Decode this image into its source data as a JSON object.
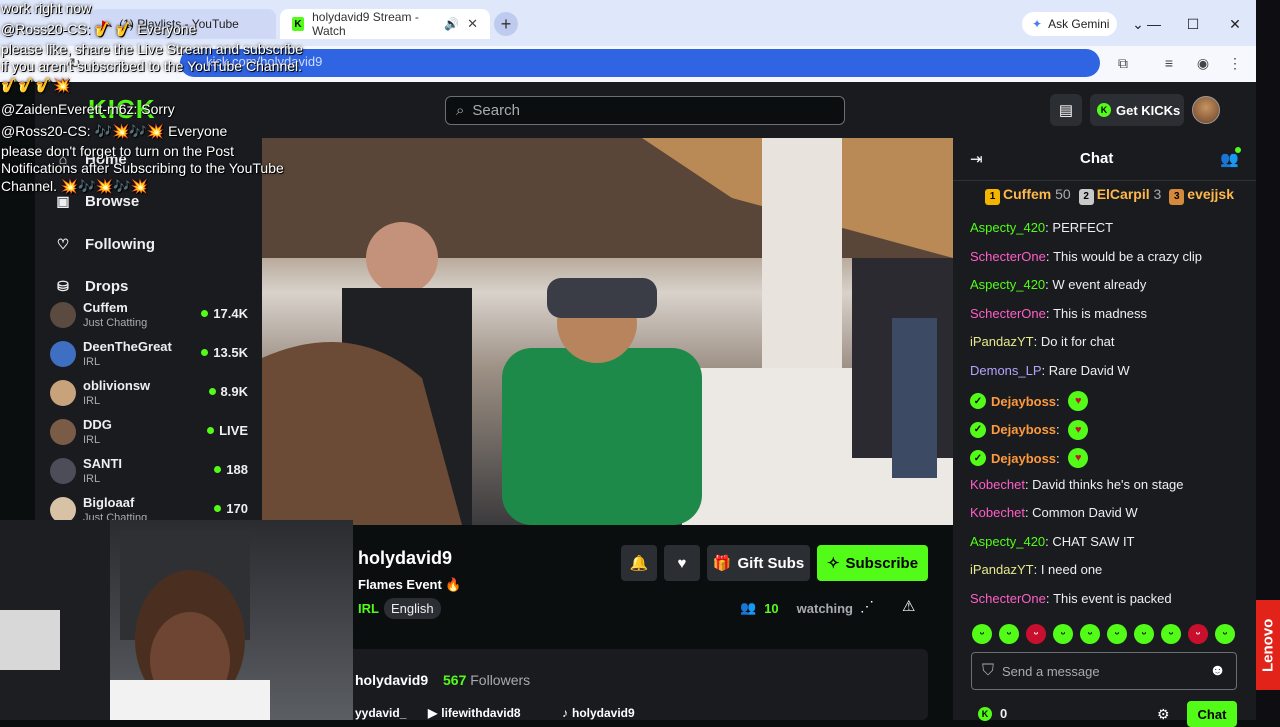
{
  "browser": {
    "tabs": [
      {
        "label": "(1) Playlists - YouTube"
      },
      {
        "label": "holydavid9 Stream - Watch"
      }
    ],
    "new_tab": "+",
    "gemini_label": "Ask Gemini",
    "url": "kick.com/holydavid9"
  },
  "kick": {
    "logo": "KICK",
    "search_placeholder": "Search",
    "get_kicks": "Get KICKs"
  },
  "nav": [
    {
      "label": "Home"
    },
    {
      "label": "Browse"
    },
    {
      "label": "Following"
    },
    {
      "label": "Drops"
    }
  ],
  "channels": [
    {
      "name": "Cuffem",
      "category": "Just Chatting",
      "count": "17.4K",
      "avatar": "#5a4a3f"
    },
    {
      "name": "DeenTheGreat",
      "category": "IRL",
      "count": "13.5K",
      "avatar": "#3f6fc2"
    },
    {
      "name": "oblivionsw",
      "category": "IRL",
      "count": "8.9K",
      "avatar": "#c8a27a"
    },
    {
      "name": "DDG",
      "category": "IRL",
      "count": "LIVE",
      "avatar": "#7a5c46"
    },
    {
      "name": "SANTI",
      "category": "IRL",
      "count": "188",
      "avatar": "#4d4d5a"
    },
    {
      "name": "Bigloaaf",
      "category": "Just Chatting",
      "count": "170",
      "avatar": "#d7c2a6"
    }
  ],
  "stream": {
    "streamer": "holydavid9",
    "title": "Flames Event 🔥",
    "category": "IRL",
    "language": "English",
    "gift_subs": "Gift Subs",
    "subscribe": "Subscribe",
    "viewers": "10",
    "watching_label": "watching"
  },
  "about": {
    "name": "holydavid9",
    "followers_count": "567",
    "followers_label": "Followers",
    "socials": [
      "yydavid_",
      "lifewithdavid8",
      "holydavid9"
    ]
  },
  "chat": {
    "title": "Chat",
    "leaderboard": [
      {
        "rank": "1",
        "name": "Cuffem",
        "points": "50",
        "color": "#f5b400"
      },
      {
        "rank": "2",
        "name": "ElCarpil",
        "points": "3",
        "color": "#c9c9c9"
      },
      {
        "rank": "3",
        "name": "evejjsk",
        "points": "",
        "color": "#d48a3a"
      }
    ],
    "messages": [
      {
        "user": "Aspecty_420",
        "color": "#53fc18",
        "text": "PERFECT"
      },
      {
        "user": "SchecterOne",
        "color": "#ff5fc7",
        "text": "This would be a crazy clip"
      },
      {
        "user": "Aspecty_420",
        "color": "#53fc18",
        "text": "W event already"
      },
      {
        "user": "SchecterOne",
        "color": "#ff5fc7",
        "text": "This is madness"
      },
      {
        "user": "iPandazYT",
        "color": "#e6e88a",
        "text": "Do it for chat"
      },
      {
        "user": "Demons_LP",
        "color": "#b6a4ff",
        "text": "Rare David W"
      },
      {
        "user": "Dejayboss",
        "color": "#ff9a3c",
        "text": ""
      },
      {
        "user": "Dejayboss",
        "color": "#ff9a3c",
        "text": ""
      },
      {
        "user": "Dejayboss",
        "color": "#ff9a3c",
        "text": ""
      },
      {
        "user": "Kobechet",
        "color": "#ff5fc7",
        "text": "David thinks he's on stage"
      },
      {
        "user": "Kobechet",
        "color": "#ff5fc7",
        "text": "Common David W"
      },
      {
        "user": "Aspecty_420",
        "color": "#53fc18",
        "text": "CHAT SAW IT"
      },
      {
        "user": "iPandazYT",
        "color": "#e6e88a",
        "text": "I need one"
      },
      {
        "user": "SchecterOne",
        "color": "#ff5fc7",
        "text": "This event is packed"
      }
    ],
    "input_placeholder": "Send a message",
    "kicks_balance": "0",
    "send_label": "Chat"
  },
  "overlay": [
    "work right now",
    "@Ross20-CS: 🎷 🎷 Everyone",
    "please like, share the Live Stream and subscribe",
    "if you aren't subscribed to the YouTube Channel.",
    "🎷🎷🎷💥",
    "@ZaidenEverett-m6z: Sorry",
    "@Ross20-CS: 🎶💥🎶💥 Everyone",
    "please don't forget to turn on the Post",
    "Notifications after Subscribing to the YouTube",
    "Channel. 💥🎶💥🎶💥"
  ],
  "taskbar": {
    "brand": "Lenovo"
  }
}
